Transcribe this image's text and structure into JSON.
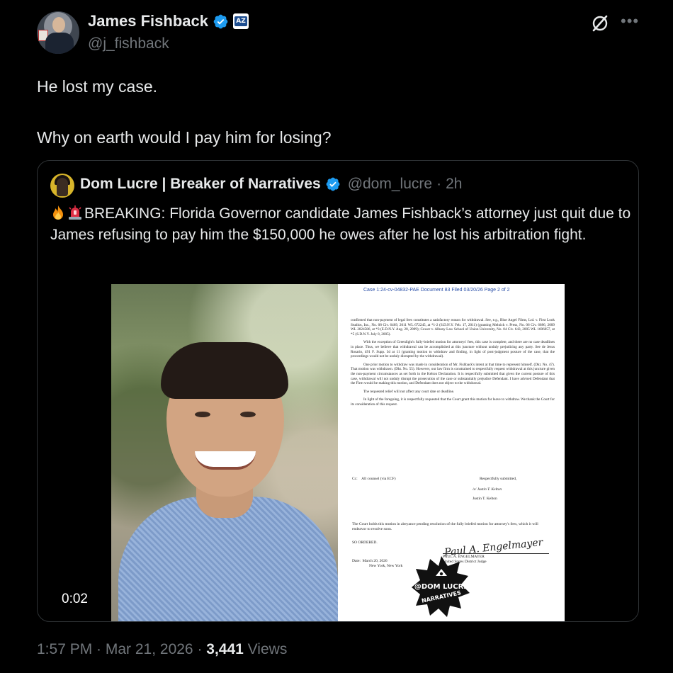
{
  "author": {
    "name": "James Fishback",
    "handle": "@j_fishback",
    "badge_label": "AZ"
  },
  "tweet": {
    "line1": "He lost my case.",
    "line2": "Why on earth would I pay him for losing?"
  },
  "quote": {
    "author_name": "Dom Lucre | Breaker of Narratives",
    "author_handle": "@dom_lucre",
    "time": "2h",
    "text": "BREAKING: Florida Governor candidate James Fishback’s attorney just quit due to James refusing to pay him the $150,000 he owes after he lost his arbitration fight.",
    "video_timer": "0:02",
    "document": {
      "header": "Case 1:24-cv-04832-PAE    Document 83    Filed 03/20/26    Page 2 of 2",
      "para1": "confirmed that non-payment of legal fees constitutes a satisfactory reason for withdrawal. See, e.g., Blue Angel Films, Ltd. v. First Look Studios, Inc., No. 08 Civ. 6469, 2011 WL 672245, at *1-2 (S.D.N.Y. Feb. 17, 2011) (granting Melnick v. Press, No. 06 Civ. 6686, 2009 WL 2824586, at *3 (E.D.N.Y. Aug. 28, 2009); Cower v. Albany Law School of Union University, No. 04 Civ. 643, 2005 WL 1606057, at *5 (S.D.N.Y. July 8, 2005).",
      "para2": "With the exception of Greenlight's fully-briefed motion for attorneys' fees, this case is complete, and there are no case deadlines in place. Thus, we believe that withdrawal can be accomplished at this juncture without unduly prejudicing any party. See de Jesus Rosario, 491 F. Supp. 3d at 11 (granting motion to withdraw and finding, in light of post-judgment posture of the case, that the proceedings would not be unduly disrupted by the withdrawal).",
      "para3": "One prior motion to withdraw was made in consideration of Mr. Fishback's intent at that time to represent himself. (Dkt. No. 47). That motion was withdrawn. (Dkt. No. 55). However, our law firm is constrained to respectfully request withdrawal at this juncture given the non-payment circumstances as set forth in the Kelton Declaration. It is respectfully submitted that given the current posture of this case, withdrawal will not unduly disrupt the prosecution of the case or substantially prejudice Defendant. I have advised Defendant that the Firm would be making this motion, and Defendant does not object to the withdrawal.",
      "para4": "The requested relief will not affect any court date or deadline.",
      "para5": "In light of the foregoing, it is respectfully requested that the Court grant this motion for leave to withdraw. We thank the Court for its consideration of this request.",
      "cc_label": "Cc:",
      "cc_value": "All counsel (via ECF)",
      "closing": "Respectfully submitted,",
      "sig_line": "/s/ Justin T. Kelton",
      "signer": "Justin T. Kelton",
      "court_holds": "The Court holds this motion in abeyance pending resolution of the fully briefed motion for attorney's fees, which it will endeavor to resolve soon.",
      "so_ordered": "SO ORDERED.",
      "date_label": "Date:",
      "date_value": "March 20, 2026",
      "place": "New York, New York",
      "signature": "Paul A. Engelmayer",
      "judge_name": "PAUL A. ENGELMAYER",
      "judge_title": "United States District Judge",
      "watermark_text_top": "@DOM LUCRE",
      "watermark_text_bottom": "NARRATIVES"
    }
  },
  "footer": {
    "time": "1:57 PM · Mar 21, 2026 · ",
    "views_count": "3,441",
    "views_label": " Views"
  },
  "colors": {
    "background": "#000000",
    "text": "#e7e9ea",
    "muted": "#71767b",
    "verified": "#1d9bf0",
    "border": "#2f3336"
  }
}
